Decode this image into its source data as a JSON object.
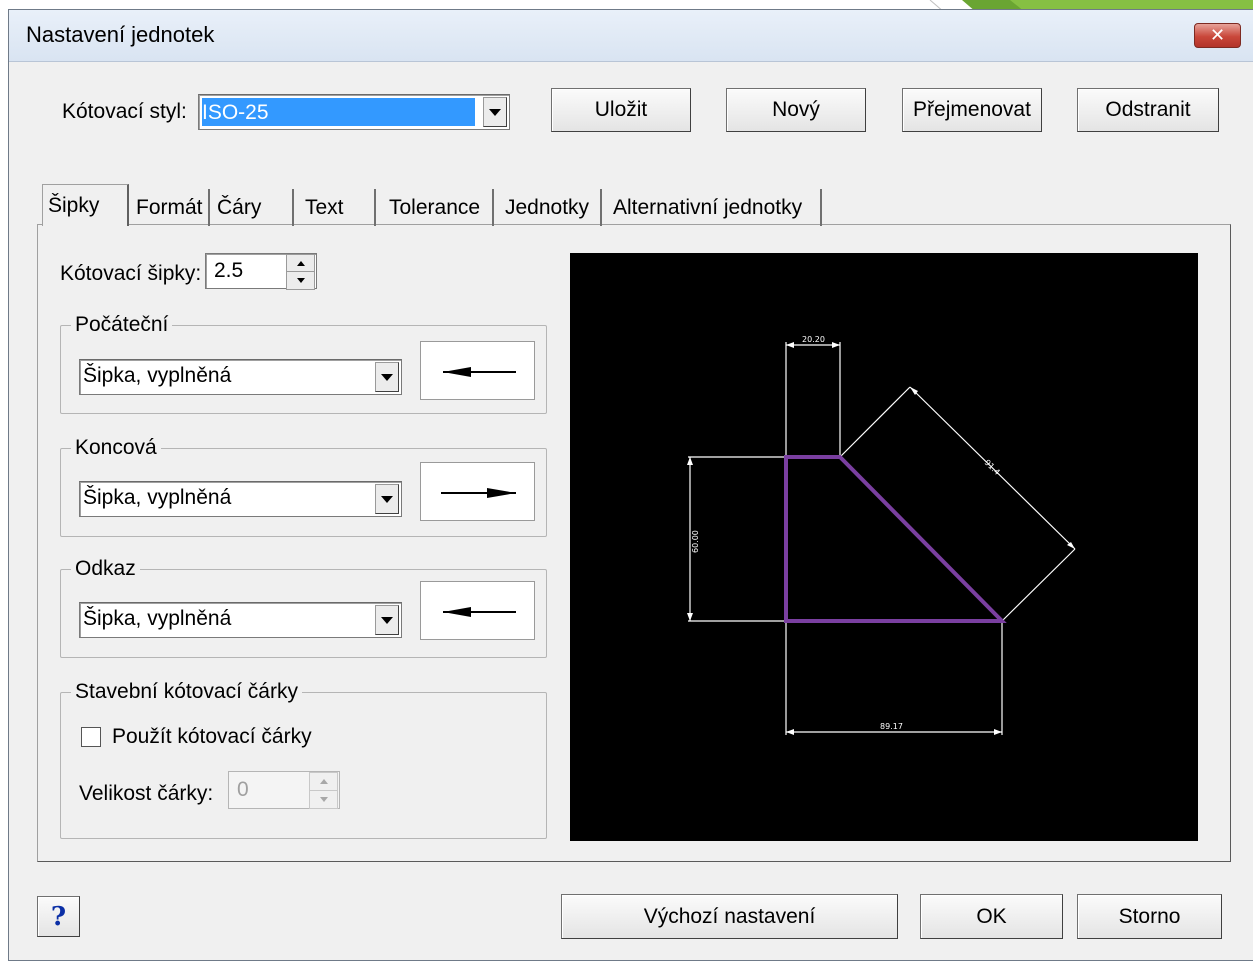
{
  "window": {
    "title": "Nastavení jednotek",
    "close_symbol": "✕"
  },
  "top_row": {
    "style_label": "Kótovací styl:",
    "style_value": "ISO-25",
    "buttons": {
      "save": "Uložit",
      "new": "Nový",
      "rename": "Přejmenovat",
      "delete": "Odstranit"
    }
  },
  "tabs": [
    {
      "label": "Šipky",
      "active": true
    },
    {
      "label": "Formát"
    },
    {
      "label": "Čáry"
    },
    {
      "label": "Text"
    },
    {
      "label": "Tolerance"
    },
    {
      "label": "Jednotky"
    },
    {
      "label": "Alternativní jednotky"
    }
  ],
  "arrows_tab": {
    "arrow_size_label": "Kótovací šipky:",
    "arrow_size_value": "2.5",
    "start": {
      "title": "Počáteční",
      "value": "Šipka, vyplněná"
    },
    "end": {
      "title": "Koncová",
      "value": "Šipka, vyplněná"
    },
    "leader": {
      "title": "Odkaz",
      "value": "Šipka, vyplněná"
    },
    "ticks": {
      "title": "Stavební kótovací čárky",
      "use_label": "Použít kótovací čárky",
      "use_checked": false,
      "size_label": "Velikost čárky:",
      "size_value": "0"
    }
  },
  "preview": {
    "dim_top": "20.20",
    "dim_left": "60.00",
    "dim_bottom": "89.17",
    "dim_diagonal": "91.4",
    "shape_color": "#7a3fa0"
  },
  "footer": {
    "help": "?",
    "defaults": "Výchozí nastavení",
    "ok": "OK",
    "cancel": "Storno"
  }
}
